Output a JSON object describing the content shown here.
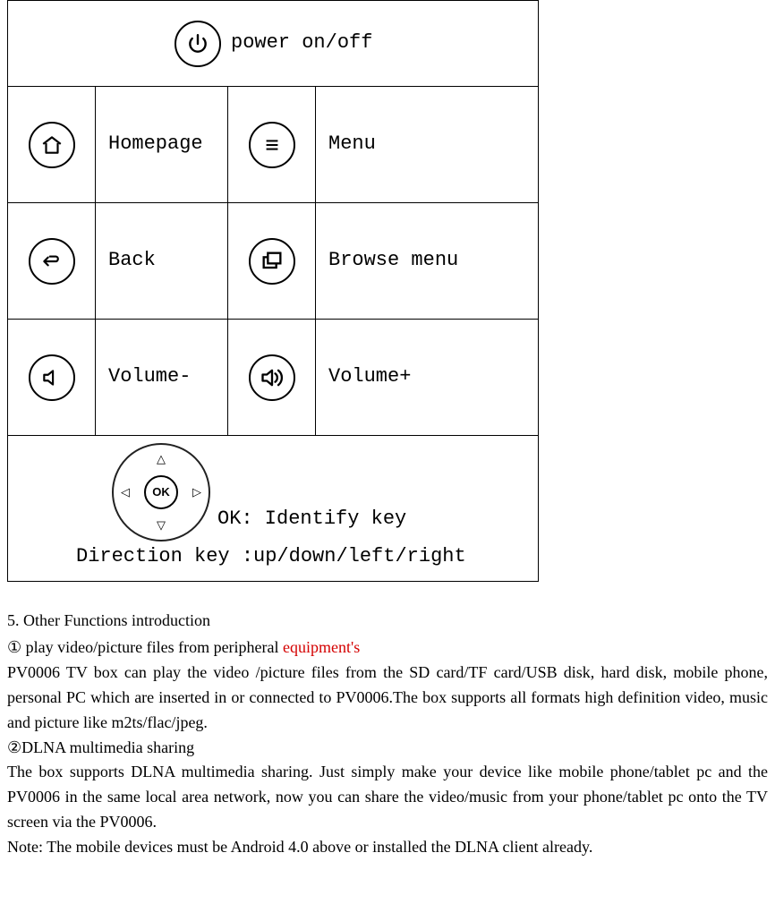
{
  "table": {
    "row1": {
      "label": "power on/off"
    },
    "row2": {
      "left_label": "Homepage",
      "right_label": "Menu"
    },
    "row3": {
      "left_label": "Back",
      "right_label": "Browse menu"
    },
    "row4": {
      "left_label": "Volume-",
      "right_label": "Volume+"
    },
    "row5": {
      "ok_label": "OK: Identify key",
      "dir_label": "Direction key :up/down/left/right",
      "ok_button_text": "OK"
    }
  },
  "section": {
    "heading": "5.    Other Functions introduction",
    "item1_prefix": "①  play video/picture files from peripheral ",
    "item1_red": "equipment's",
    "item1_para": "PV0006 TV box can play the video /picture files from the SD card/TF card/USB disk, hard disk, mobile phone, personal PC which are inserted in or connected to PV0006.The box supports all formats high definition video, music and picture like m2ts/flac/jpeg.",
    "item2_heading": "②DLNA multimedia sharing",
    "item2_para": "The box supports DLNA multimedia sharing. Just simply make your device like mobile phone/tablet pc and the PV0006 in the same local area network, now you can share the video/music from your phone/tablet pc onto the TV screen via the PV0006.",
    "note": "Note: The mobile devices must be Android 4.0 above or installed the DLNA client already."
  }
}
